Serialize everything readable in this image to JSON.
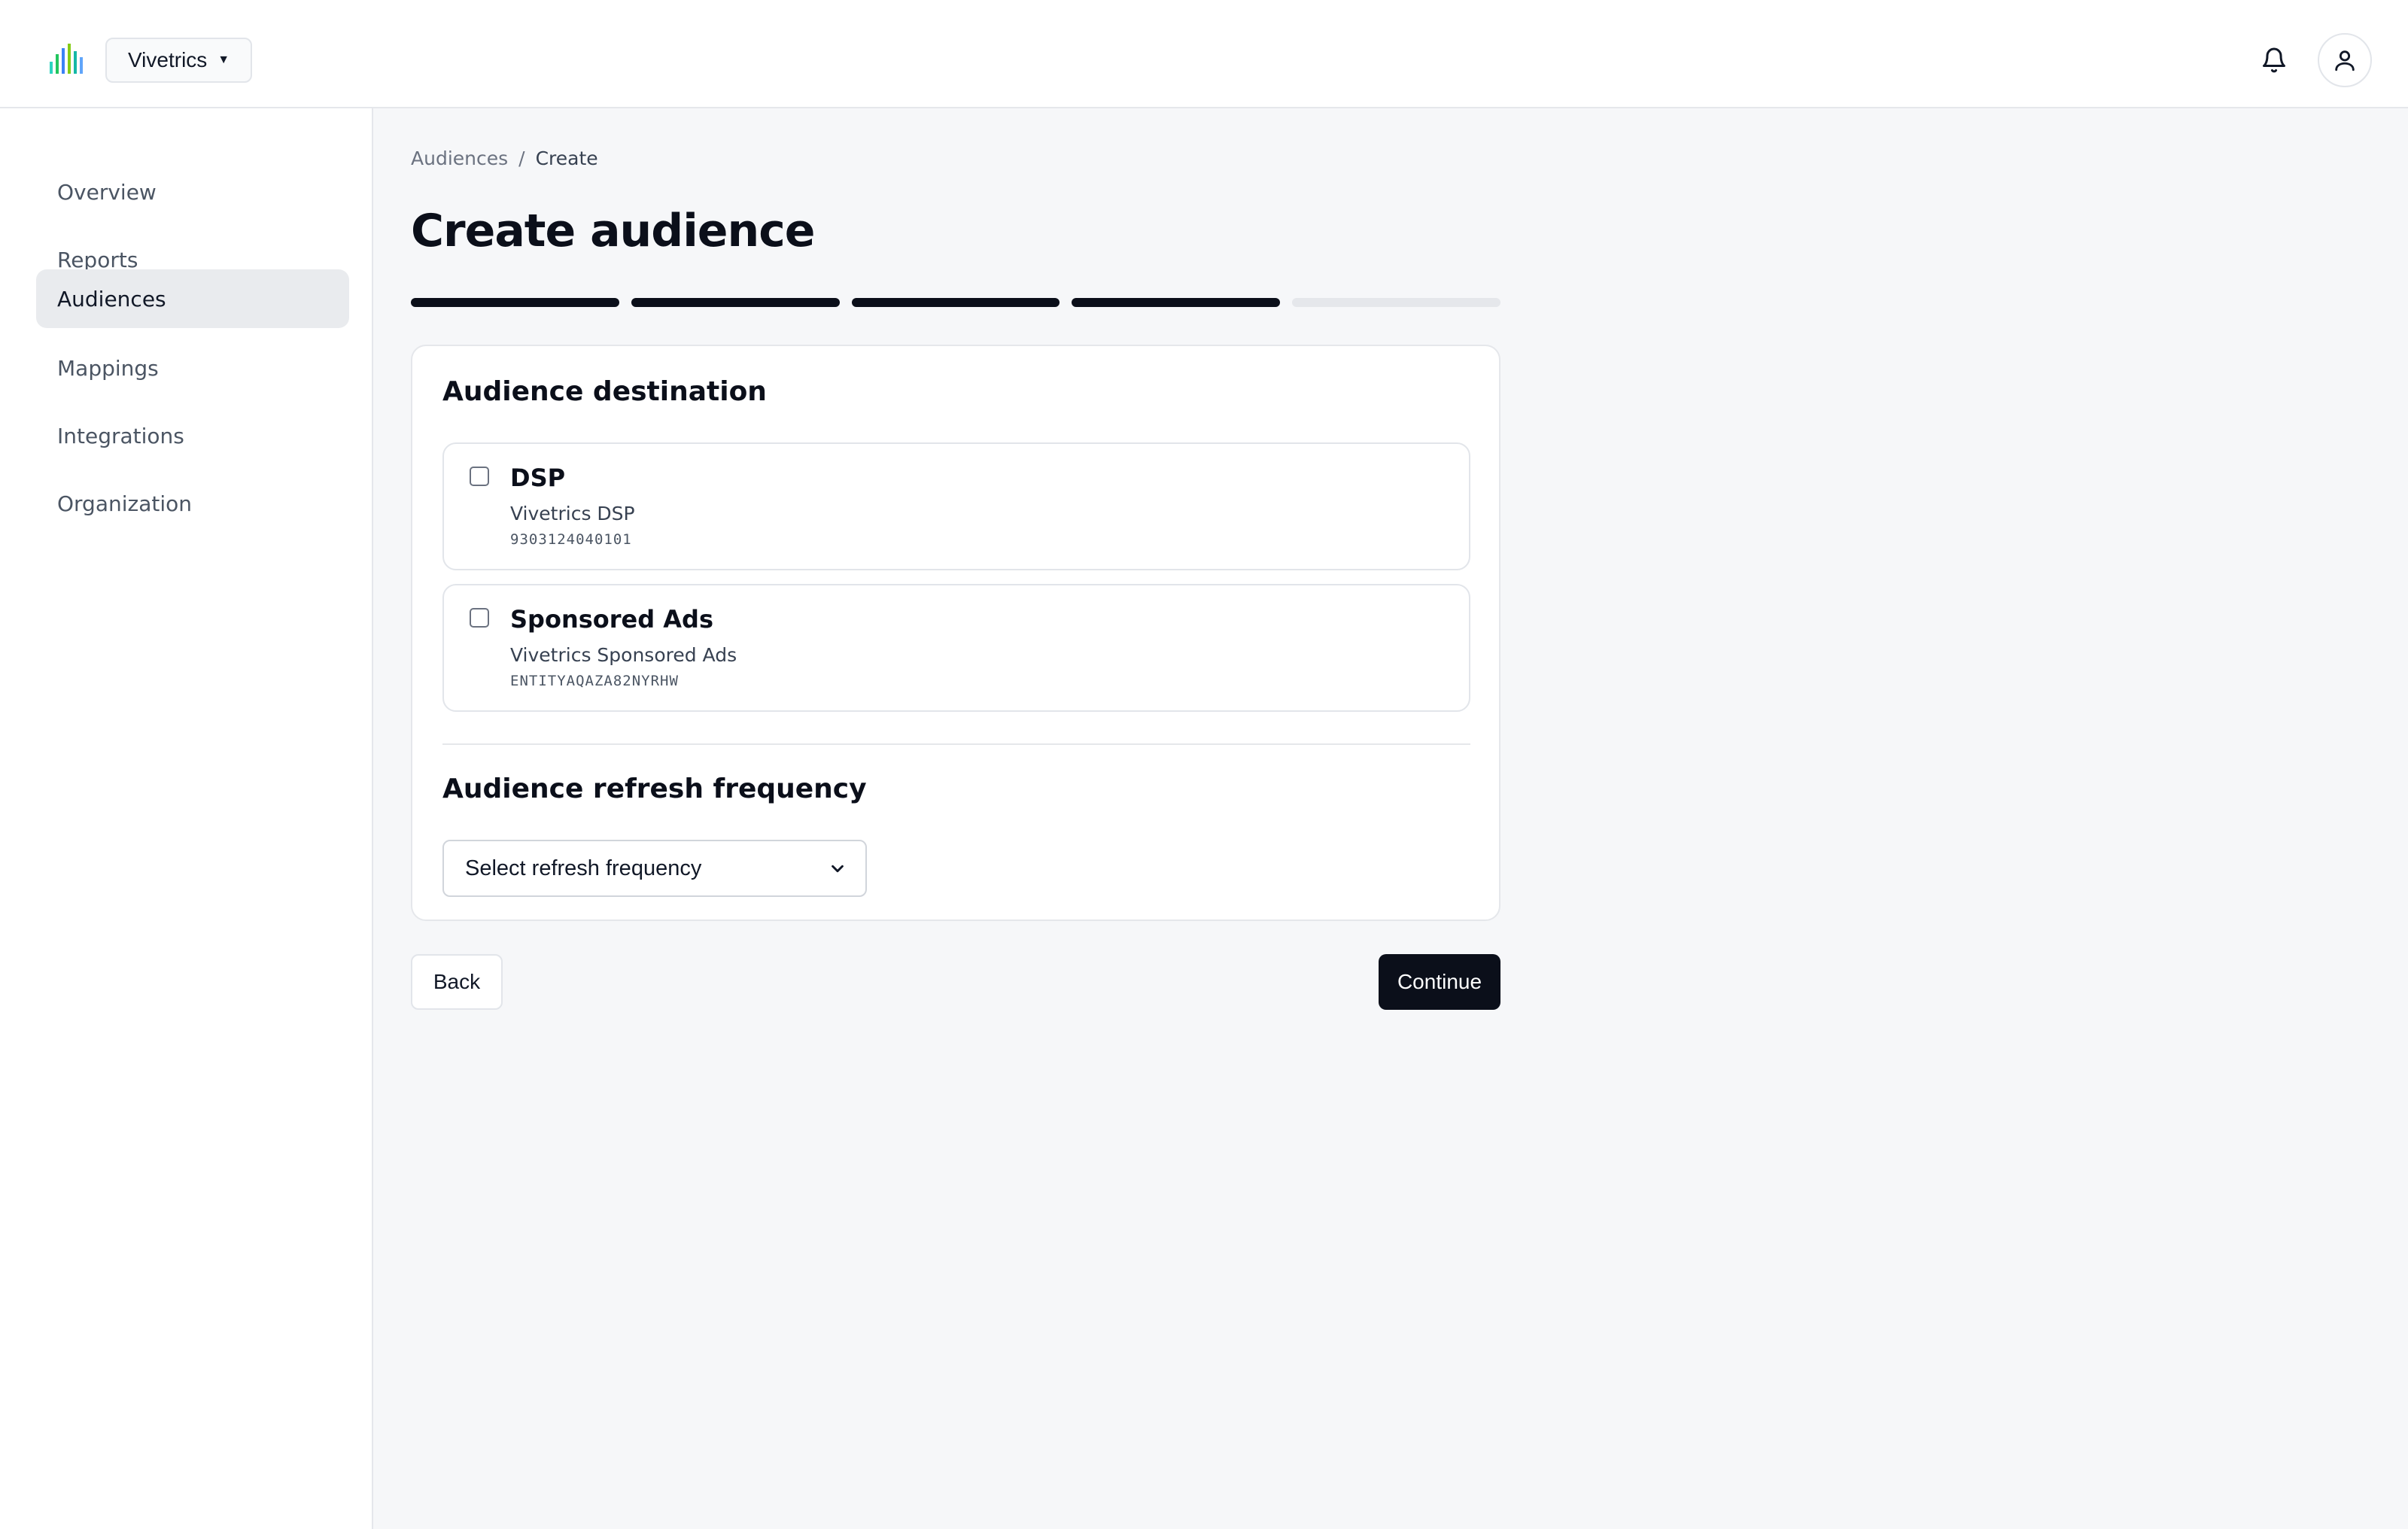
{
  "header": {
    "org_name": "Vivetrics",
    "logo_icon": "bar-chart-logo",
    "notification_icon": "bell-icon",
    "profile_icon": "user-icon",
    "logo_colors": [
      "#2dd4bf",
      "#22c55e",
      "#3b82f6",
      "#84cc16",
      "#14b8a6",
      "#60a5fa"
    ]
  },
  "sidebar": {
    "items": [
      {
        "label": "Overview",
        "active": false
      },
      {
        "label": "Reports",
        "active": false
      },
      {
        "label": "Audiences",
        "active": true
      },
      {
        "label": "Mappings",
        "active": false
      },
      {
        "label": "Integrations",
        "active": false
      },
      {
        "label": "Organization",
        "active": false
      }
    ]
  },
  "breadcrumb": {
    "parent": "Audiences",
    "separator": "/",
    "current": "Create"
  },
  "page": {
    "title": "Create audience"
  },
  "stepper": {
    "total_steps": 5,
    "completed_steps": 4
  },
  "destination": {
    "title": "Audience destination",
    "options": [
      {
        "title": "DSP",
        "subtitle": "Vivetrics DSP",
        "id": "9303124040101",
        "checked": false
      },
      {
        "title": "Sponsored Ads",
        "subtitle": "Vivetrics Sponsored Ads",
        "id": "ENTITYAQAZA82NYRHW",
        "checked": false
      }
    ]
  },
  "refresh": {
    "title": "Audience refresh frequency",
    "select_value": "Select refresh frequency"
  },
  "actions": {
    "back_label": "Back",
    "continue_label": "Continue"
  },
  "colors": {
    "primary": "#0b0f1a",
    "active_nav_bg": "#e9ebee",
    "page_bg": "#f6f7f9"
  }
}
